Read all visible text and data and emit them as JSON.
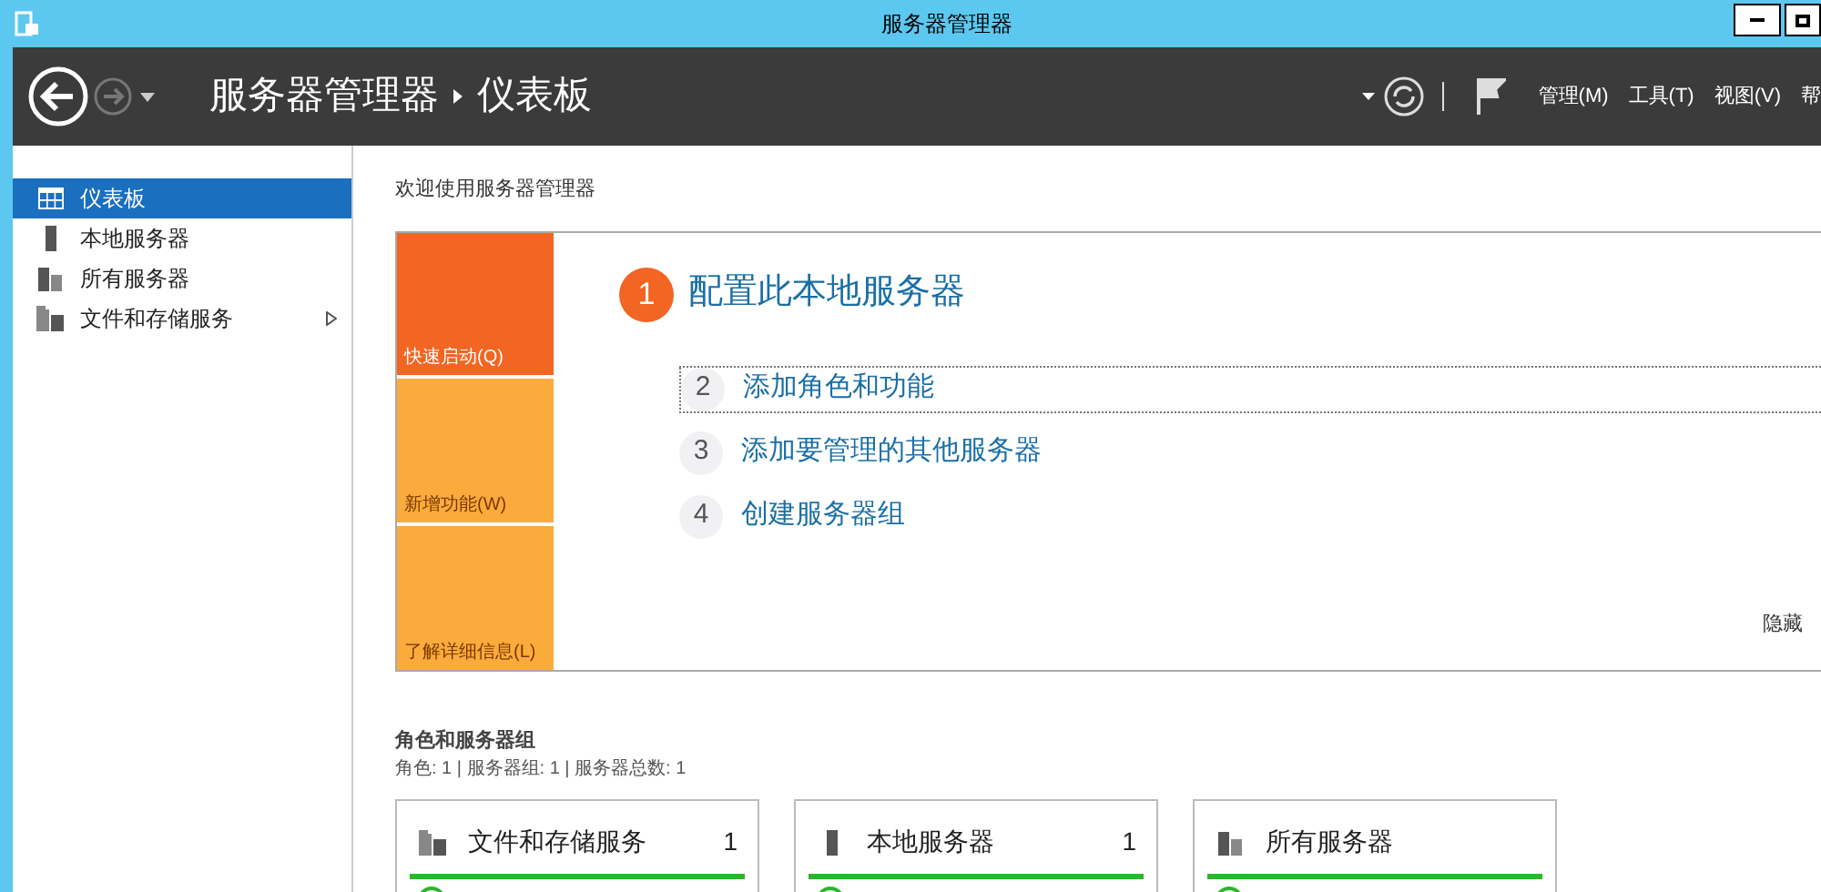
{
  "window": {
    "title": "服务器管理器"
  },
  "header": {
    "breadcrumb": [
      "服务器管理器",
      "仪表板"
    ],
    "menus": [
      "管理(M)",
      "工具(T)",
      "视图(V)",
      "帮"
    ]
  },
  "sidebar": {
    "items": [
      {
        "label": "仪表板",
        "selected": true,
        "expandable": false
      },
      {
        "label": "本地服务器",
        "selected": false,
        "expandable": false
      },
      {
        "label": "所有服务器",
        "selected": false,
        "expandable": false
      },
      {
        "label": "文件和存储服务",
        "selected": false,
        "expandable": true
      }
    ]
  },
  "welcome": {
    "heading": "欢迎使用服务器管理器",
    "tiles": [
      {
        "label": "快速启动(Q)",
        "kind": "primary"
      },
      {
        "label": "新增功能(W)",
        "kind": "secondary"
      },
      {
        "label": "了解详细信息(L)",
        "kind": "secondary"
      }
    ],
    "steps": [
      {
        "number": "1",
        "label": "配置此本地服务器",
        "kind": "main"
      },
      {
        "number": "2",
        "label": "添加角色和功能",
        "kind": "focused"
      },
      {
        "number": "3",
        "label": "添加要管理的其他服务器",
        "kind": "sub"
      },
      {
        "number": "4",
        "label": "创建服务器组",
        "kind": "sub"
      }
    ],
    "hide": "隐藏"
  },
  "roles": {
    "title": "角色和服务器组",
    "summary": "角色: 1 | 服务器组: 1 | 服务器总数: 1",
    "cards": [
      {
        "title": "文件和存储服务",
        "count": "1"
      },
      {
        "title": "本地服务器",
        "count": "1"
      },
      {
        "title": "所有服务器"
      }
    ]
  }
}
